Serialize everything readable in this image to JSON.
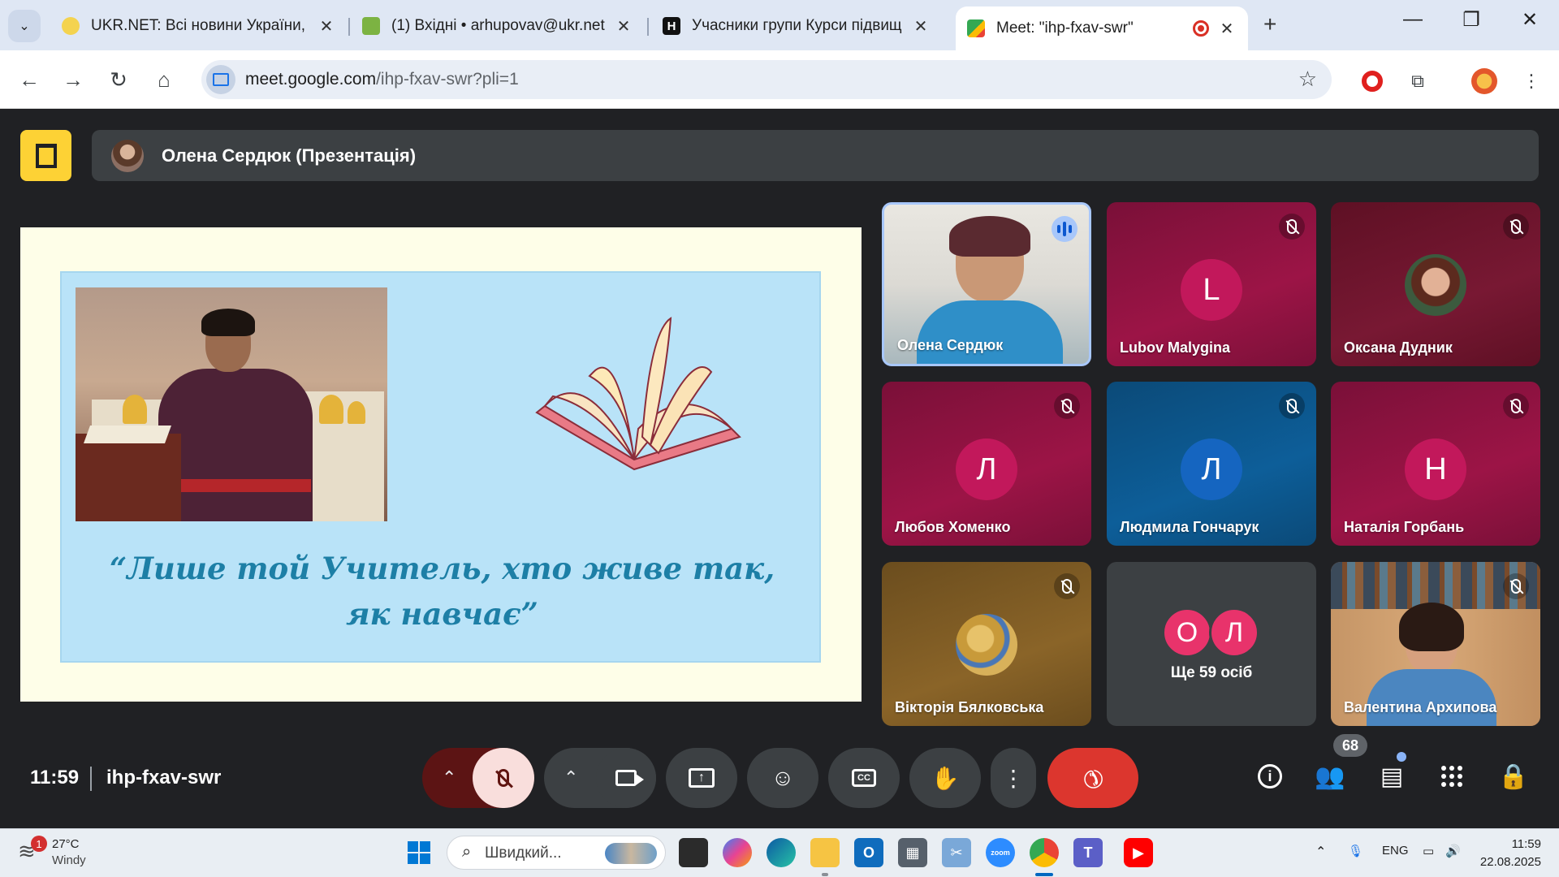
{
  "browser": {
    "tabs": [
      {
        "title": "UKR.NET: Всі новини України, о"
      },
      {
        "title": "(1) Вхідні • arhupovav@ukr.net"
      },
      {
        "title": "Учасники групи Курси підвищ"
      },
      {
        "title": "Meet: \"ihp-fxav-swr\""
      }
    ],
    "url_host": "meet.google.com",
    "url_path": "/ihp-fxav-swr?pli=1"
  },
  "meet": {
    "presenter_label": "Олена Сердюк (Презентація)",
    "slide_quote": "“Лише той Учитель, хто живе так, як навчає”",
    "participants": [
      {
        "name": "Олена Сердюк",
        "speaking": true
      },
      {
        "name": "Lubov Malygina",
        "initial": "L",
        "color": "#c2185b"
      },
      {
        "name": "Оксана Дудник"
      },
      {
        "name": "Любов Хоменко",
        "initial": "Л",
        "color": "#c2185b"
      },
      {
        "name": "Людмила Гончарук",
        "initial": "Л",
        "color": "#1565c0"
      },
      {
        "name": "Наталія Горбань",
        "initial": "Н",
        "color": "#c2185b"
      },
      {
        "name": "Вікторія Бялковська"
      },
      {
        "name": "Валентина Архипова"
      }
    ],
    "more": {
      "initials": [
        "О",
        "Л"
      ],
      "label": "Ще 59 осіб"
    },
    "time": "11:59",
    "meeting_code": "ihp-fxav-swr",
    "participant_count": "68"
  },
  "taskbar": {
    "weather_temp": "27°C",
    "weather_desc": "Windy",
    "weather_badge": "1",
    "search_placeholder": "Швидкий...",
    "lang": "ENG",
    "clock_time": "11:59",
    "clock_date": "22.08.2025"
  }
}
